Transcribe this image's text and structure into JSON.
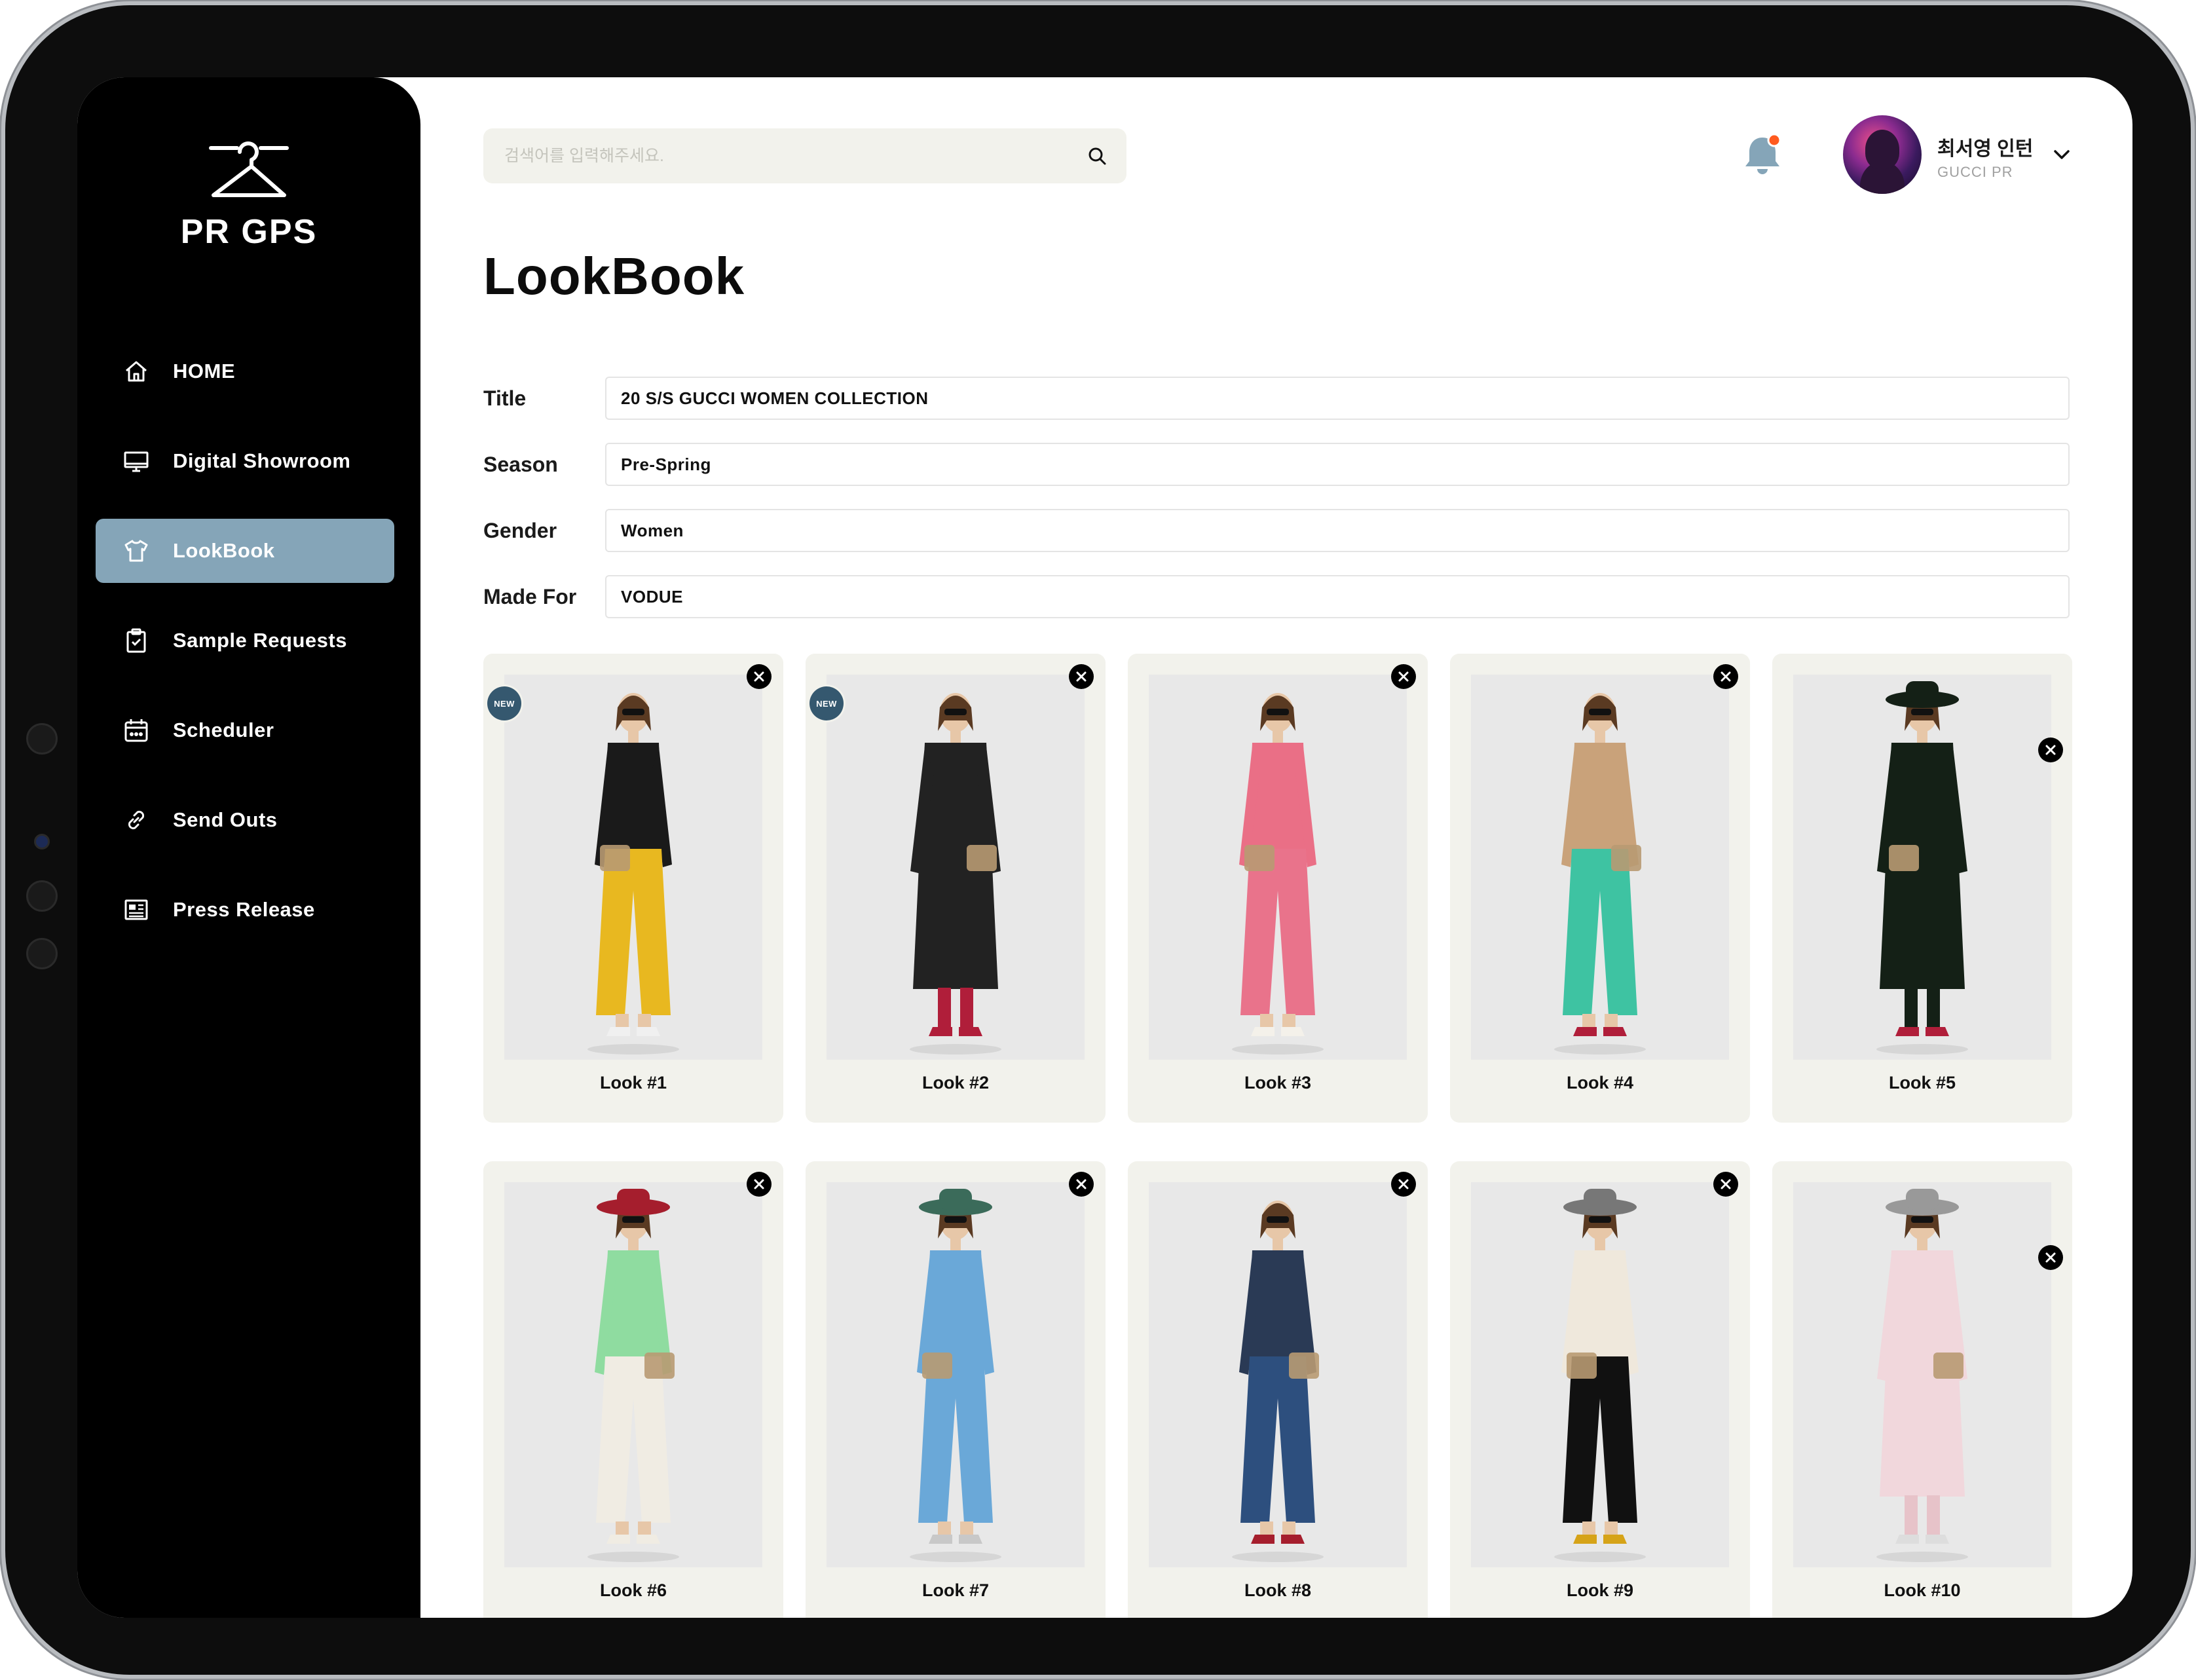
{
  "app": {
    "logo_text": "PR GPS"
  },
  "sidebar": {
    "items": [
      {
        "label": "HOME",
        "icon": "home-icon",
        "active": false
      },
      {
        "label": "Digital Showroom",
        "icon": "monitor-icon",
        "active": false
      },
      {
        "label": "LookBook",
        "icon": "shirt-icon",
        "active": true
      },
      {
        "label": "Sample Requests",
        "icon": "clipboard-icon",
        "active": false
      },
      {
        "label": "Scheduler",
        "icon": "calendar-icon",
        "active": false
      },
      {
        "label": "Send Outs",
        "icon": "link-icon",
        "active": false
      },
      {
        "label": "Press Release",
        "icon": "newspaper-icon",
        "active": false
      }
    ]
  },
  "header": {
    "search": {
      "placeholder": "검색어를 입력해주세요.",
      "value": ""
    },
    "notifications": {
      "has_unread": true
    },
    "user": {
      "name": "최서영 인턴",
      "role": "GUCCI PR"
    }
  },
  "page": {
    "title": "LookBook",
    "form": {
      "title": {
        "label": "Title",
        "value": "20 S/S GUCCI WOMEN COLLECTION"
      },
      "season": {
        "label": "Season",
        "value": "Pre-Spring"
      },
      "gender": {
        "label": "Gender",
        "value": "Women"
      },
      "made_for": {
        "label": "Made For",
        "value": "VODUE"
      }
    }
  },
  "badge_label": "NEW",
  "colors": {
    "sidebar_bg": "#000000",
    "accent": "#85a5b8",
    "card_bg": "#f2f2ec",
    "badge": "#35586f",
    "notification_dot": "#ff5a1f"
  },
  "looks": [
    {
      "label": "Look #1",
      "is_new": true,
      "top": "#1a1a1a",
      "bottom": "#e8b820",
      "shoes": "#f0f0f0",
      "hat": ""
    },
    {
      "label": "Look #2",
      "is_new": true,
      "top": "#222222",
      "bottom": "#b01e3a",
      "shoes": "#b01e3a",
      "hat": ""
    },
    {
      "label": "Look #3",
      "is_new": false,
      "top": "#ea6f86",
      "bottom": "#e9738b",
      "shoes": "#f4f1ea",
      "hat": ""
    },
    {
      "label": "Look #4",
      "is_new": false,
      "top": "#c9a27a",
      "bottom": "#3ec3a2",
      "shoes": "#b01e3a",
      "hat": ""
    },
    {
      "label": "Look #5",
      "is_new": false,
      "top": "#142016",
      "bottom": "#142016",
      "shoes": "#b01e3a",
      "hat": "#142016"
    },
    {
      "label": "Look #6",
      "is_new": false,
      "top": "#8fdca0",
      "bottom": "#f0ece3",
      "shoes": "#f0ece3",
      "hat": "#a51e2d"
    },
    {
      "label": "Look #7",
      "is_new": false,
      "top": "#6aa8d8",
      "bottom": "#6aa8d8",
      "shoes": "#c8c8c8",
      "hat": "#3b6b5a"
    },
    {
      "label": "Look #8",
      "is_new": false,
      "top": "#2a3a55",
      "bottom": "#2d4f7e",
      "shoes": "#a51e2d",
      "hat": ""
    },
    {
      "label": "Look #9",
      "is_new": false,
      "top": "#efe8dc",
      "bottom": "#111111",
      "shoes": "#d6a318",
      "hat": "#777777"
    },
    {
      "label": "Look #10",
      "is_new": false,
      "top": "#f1d7dc",
      "bottom": "#e7c3c9",
      "shoes": "#dddddd",
      "hat": "#999999"
    }
  ]
}
